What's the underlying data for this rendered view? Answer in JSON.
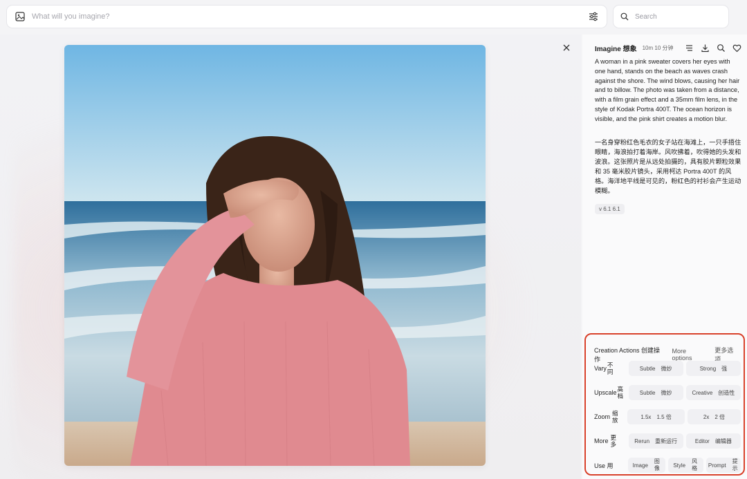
{
  "prompt": {
    "placeholder": "What will you imagine?"
  },
  "search": {
    "placeholder": "Search"
  },
  "panel": {
    "title": "Imagine 想象",
    "time": "10m 10 分钟",
    "description_en": "A woman in a pink sweater covers her eyes with one hand, stands on the beach as waves crash against the shore. The wind blows, causing her hair and to billow. The photo was taken from a distance, with a film grain effect and a 35mm film lens, in the style of Kodak Portra 400T. The ocean horizon is visible, and the pink shirt creates a motion blur.",
    "description_zh": "一名身穿粉红色毛衣的女子站在海滩上，一只手捂住眼睛，海浪拍打着海岸。风吹拂着，吹得她的头发和波浪。这张照片是从远处拍摄的，具有胶片颗粒效果和 35 毫米胶片镜头，采用柯达 Portra 400T 的风格。海洋地平线是可见的，粉红色的衬衫会产生运动模糊。",
    "version": "v 6.1 6.1"
  },
  "actions": {
    "title": "Creation Actions 创建操作",
    "more": "More options",
    "more_zh": "更多选项",
    "vary": {
      "label": "Vary",
      "zh": "不同",
      "subtle": "Subtle",
      "subtle_zh": "微妙",
      "strong": "Strong",
      "strong_zh": "强"
    },
    "upscale": {
      "label": "Upscale",
      "zh": "高档",
      "subtle": "Subtle",
      "subtle_zh": "微妙",
      "creative": "Creative",
      "creative_zh": "创造性"
    },
    "zoom": {
      "label": "Zoom",
      "zh": "缩放",
      "x15": "1.5x",
      "x15_zh": "1.5 倍",
      "x2": "2x",
      "x2_zh": "2 倍"
    },
    "more_row": {
      "label": "More",
      "zh": "更多",
      "rerun": "Rerun",
      "rerun_zh": "重新运行",
      "editor": "Editor",
      "editor_zh": "编辑器"
    },
    "use": {
      "label": "Use 用",
      "image": "Image",
      "image_zh": "图像",
      "style": "Style",
      "style_zh": "风格",
      "prompt": "Prompt",
      "prompt_zh": "提示"
    }
  },
  "colors": {
    "highlight_border": "#d9412b",
    "sweater": "#e0898f",
    "sky": "#8fc6e6"
  }
}
